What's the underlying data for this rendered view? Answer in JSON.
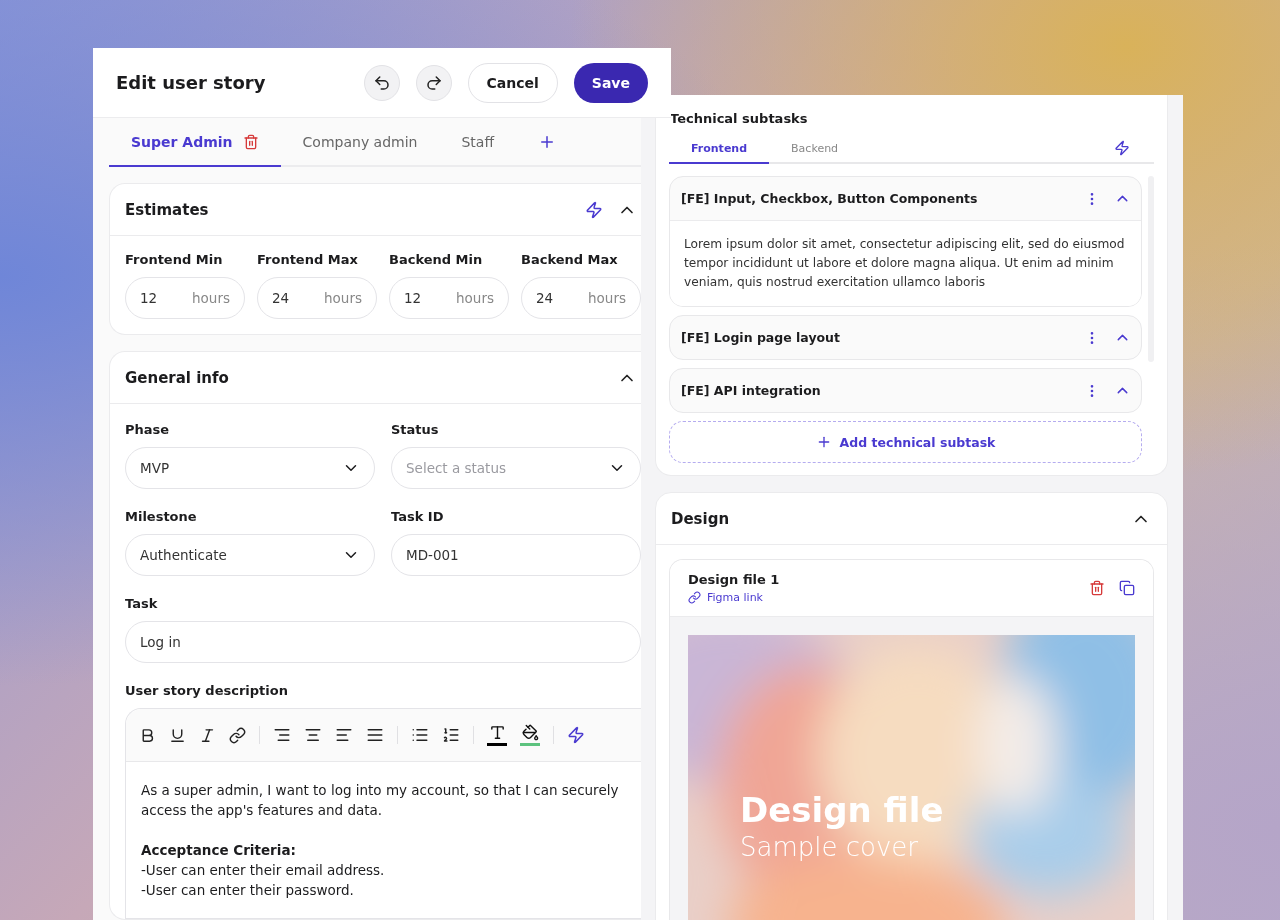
{
  "header": {
    "title": "Edit user story",
    "cancel": "Cancel",
    "save": "Save"
  },
  "role_tabs": [
    {
      "label": "Super Admin",
      "selected": true
    },
    {
      "label": "Company admin",
      "selected": false
    },
    {
      "label": "Staff",
      "selected": false
    }
  ],
  "estimates": {
    "title": "Estimates",
    "expanded": true,
    "fields": [
      {
        "label": "Frontend Min",
        "value": "12",
        "unit": "hours"
      },
      {
        "label": "Frontend Max",
        "value": "24",
        "unit": "hours"
      },
      {
        "label": "Backend Min",
        "value": "12",
        "unit": "hours"
      },
      {
        "label": "Backend Max",
        "value": "24",
        "unit": "hours"
      }
    ]
  },
  "general_info": {
    "title": "General info",
    "expanded": true,
    "fields": [
      {
        "kind": "select",
        "label": "Phase",
        "value": "MVP"
      },
      {
        "kind": "select",
        "label": "Status",
        "placeholder": "Select a status"
      },
      {
        "kind": "select",
        "label": "Milestone",
        "value": "Authenticate"
      },
      {
        "kind": "text",
        "label": "Task ID",
        "value": "MD-001"
      },
      {
        "kind": "wide",
        "label": "Task",
        "value": "Log in"
      }
    ],
    "description": {
      "label": "User story description",
      "paragraphs": [
        "As a super admin, I want to log into my account, so that I can securely access the app's features and data.",
        "**Acceptance Criteria:**\n-User can enter their email address.\n-User can enter their password."
      ]
    }
  },
  "subtasks": {
    "title": "Technical subtasks",
    "tabs": [
      {
        "label": "Frontend",
        "selected": true
      },
      {
        "label": "Backend",
        "selected": false
      }
    ],
    "items": [
      {
        "title": "[FE] Input, Checkbox, Button Components",
        "body": "Lorem ipsum dolor sit amet, consectetur adipiscing elit, sed do eiusmod tempor incididunt ut labore et dolore magna aliqua. Ut enim ad minim veniam, quis nostrud exercitation ullamco laboris"
      },
      {
        "title": "[FE] Login page layout"
      },
      {
        "title": "[FE] API integration"
      }
    ],
    "add_label": "Add technical subtask"
  },
  "design": {
    "title": "Design",
    "expanded": true,
    "files": [
      {
        "name": "Design file 1",
        "link": "Figma link",
        "cover_title": "Design file",
        "cover_subtitle": "Sample cover"
      }
    ]
  }
}
